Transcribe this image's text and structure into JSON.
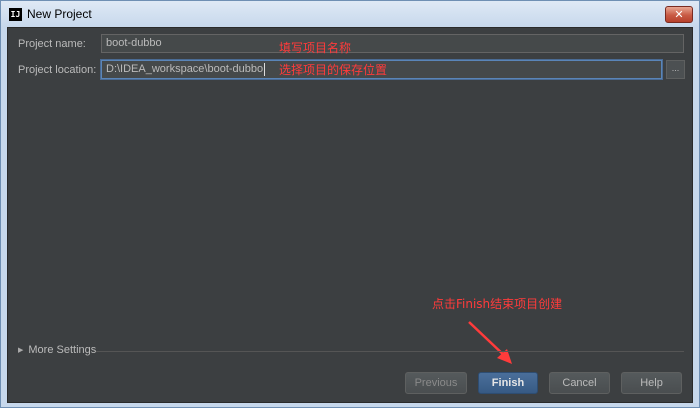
{
  "window": {
    "title": "New Project",
    "app_icon_text": "IJ",
    "close_glyph": "✕"
  },
  "form": {
    "name_label": "Project name:",
    "name_value": "boot-dubbo",
    "location_label": "Project location:",
    "location_value": "D:\\IDEA_workspace\\boot-dubbo",
    "browse_label": "..."
  },
  "annotations": {
    "name_note": "填写项目名称",
    "location_note": "选择项目的保存位置",
    "finish_note": "点击Finish结束项目创建",
    "color": "#ff3b3b"
  },
  "more_settings": {
    "label": "More Settings"
  },
  "buttons": {
    "previous": "Previous",
    "finish": "Finish",
    "cancel": "Cancel",
    "help": "Help"
  },
  "colors": {
    "panel_bg": "#3c3f41",
    "accent": "#375a84"
  }
}
